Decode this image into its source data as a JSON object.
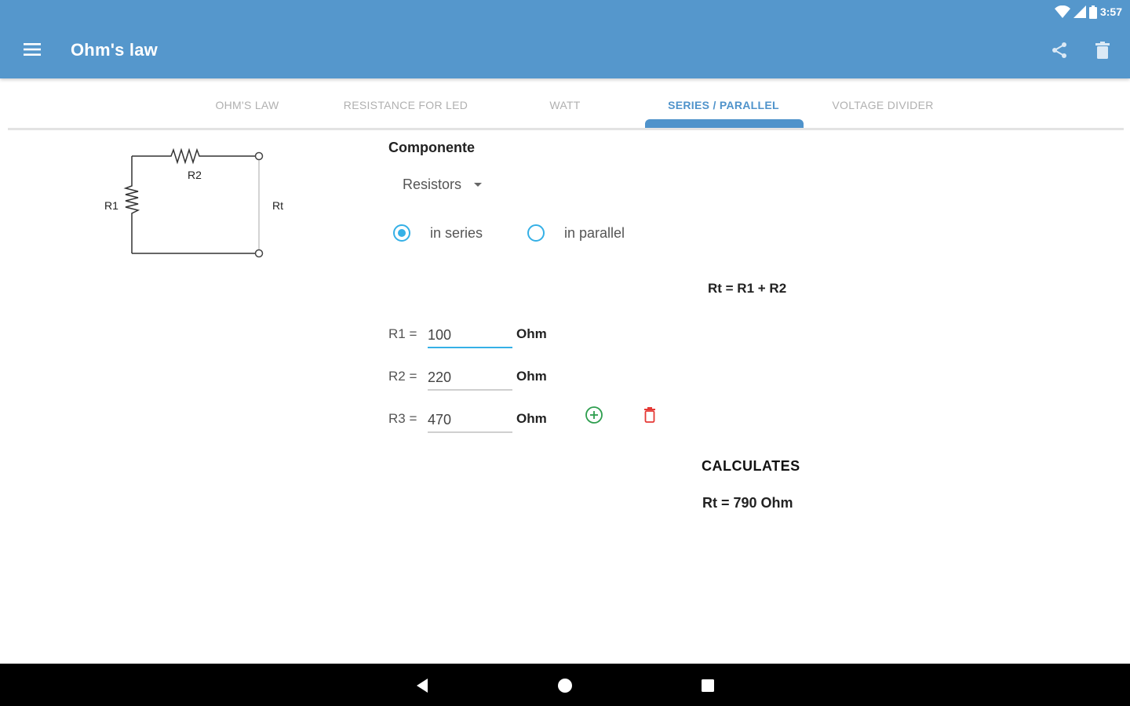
{
  "status_bar": {
    "time": "3:57"
  },
  "app_bar": {
    "title": "Ohm's law",
    "menu_icon": "menu-icon",
    "actions": [
      "share-icon",
      "trash-icon"
    ]
  },
  "tabs": [
    {
      "label": "OHM'S LAW",
      "active": false
    },
    {
      "label": "RESISTANCE FOR LED",
      "active": false
    },
    {
      "label": "WATT",
      "active": false
    },
    {
      "label": "SERIES / PARALLEL",
      "active": true
    },
    {
      "label": "VOLTAGE DIVIDER",
      "active": false
    }
  ],
  "circuit": {
    "labels": {
      "r1": "R1",
      "r2": "R2",
      "rt": "Rt"
    }
  },
  "form": {
    "section_title": "Componente",
    "component_select": {
      "selected": "Resistors"
    },
    "radio_options": [
      {
        "label": "in series",
        "checked": true
      },
      {
        "label": "in parallel",
        "checked": false
      }
    ],
    "formula": "Rt = R1 + R2",
    "resistors": [
      {
        "label": "R1 =",
        "value": "100",
        "unit": "Ohm"
      },
      {
        "label": "R2 =",
        "value": "220",
        "unit": "Ohm"
      },
      {
        "label": "R3 =",
        "value": "470",
        "unit": "Ohm"
      }
    ],
    "add_icon": "add-circle-icon",
    "delete_icon": "delete-icon"
  },
  "results": {
    "title": "CALCULATES",
    "value": "Rt = 790 Ohm"
  },
  "colors": {
    "app_bar": "#5597cc",
    "accent": "#4f93cb",
    "radio": "#35b0e6",
    "add": "#2e9e4f",
    "delete": "#e53935"
  },
  "nav_bar": [
    "back-icon",
    "home-icon",
    "recents-icon"
  ]
}
